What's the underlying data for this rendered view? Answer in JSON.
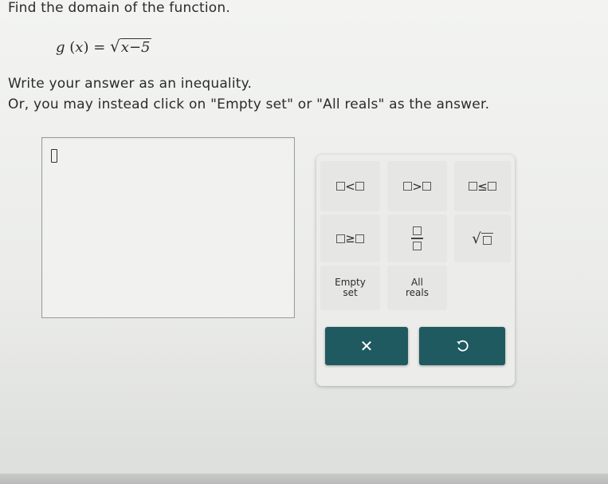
{
  "question": {
    "title": "Find the domain of the function.",
    "function": {
      "name": "g",
      "variable": "x",
      "radicand": "x−5"
    },
    "line1": "Write your answer as an inequality.",
    "line2": "Or, you may instead click on \"Empty set\" or \"All reals\" as the answer."
  },
  "keypad": {
    "less_than": "<",
    "greater_than": ">",
    "less_equal": "≤",
    "greater_equal": "≥",
    "empty_set": [
      "Empty",
      "set"
    ],
    "all_reals": [
      "All",
      "reals"
    ],
    "clear_symbol": "✕",
    "undo_icon": "undo-icon"
  },
  "colors": {
    "action_button": "#1f5a60",
    "background": "#eeefed"
  }
}
